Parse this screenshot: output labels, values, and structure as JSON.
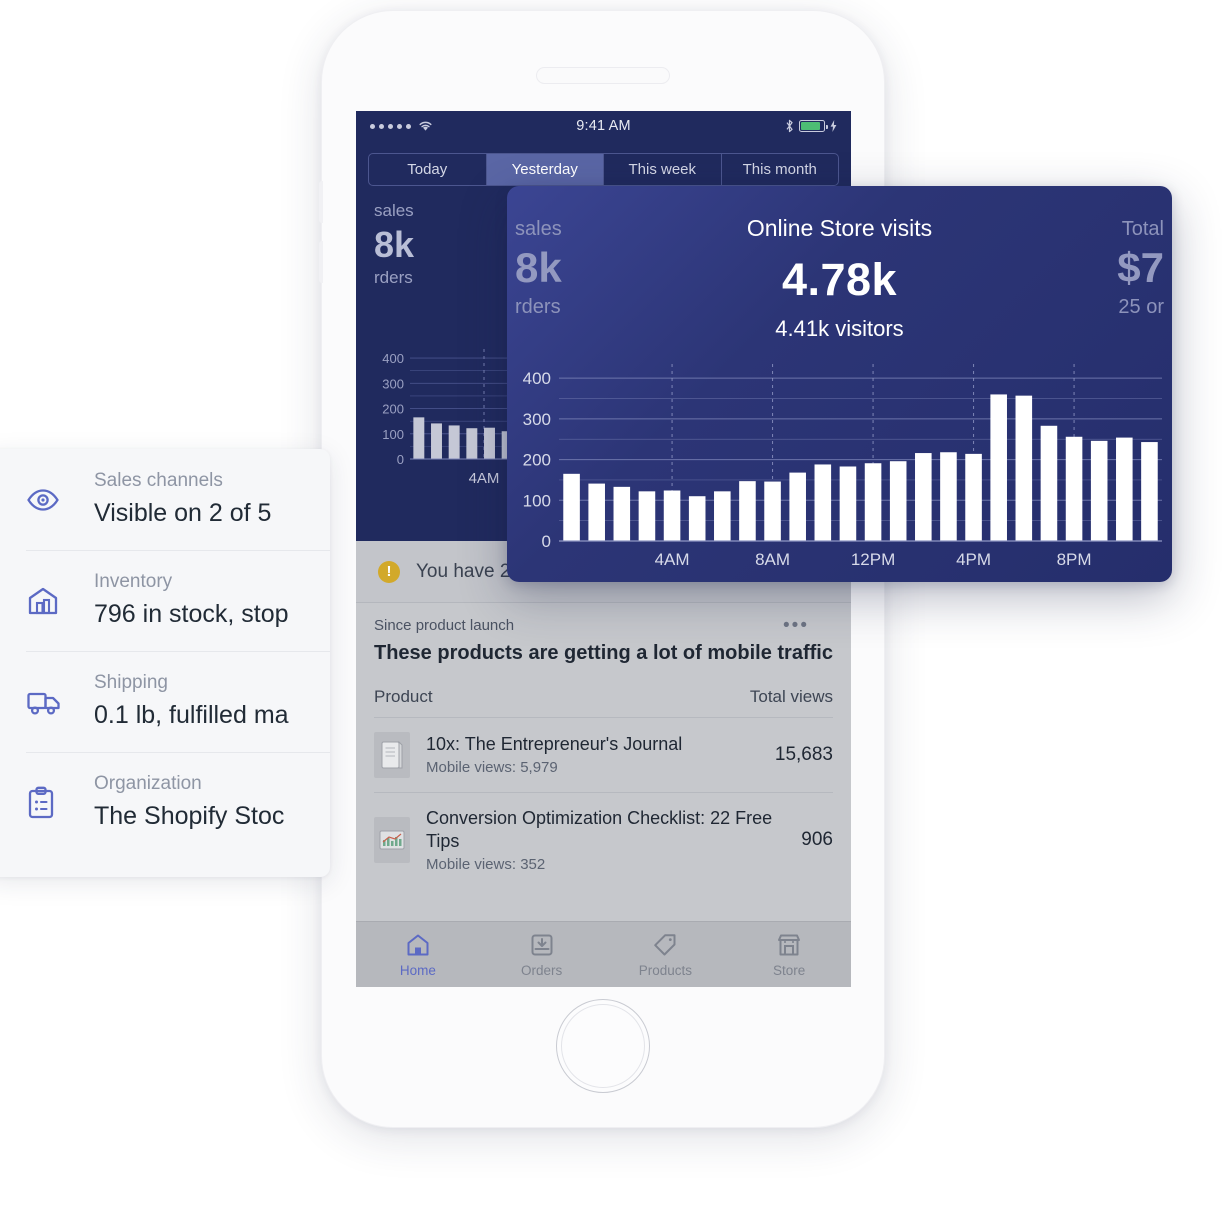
{
  "detail_panel": {
    "rows": [
      {
        "icon": "eye-icon",
        "label": "Sales channels",
        "value": "Visible on 2 of 5"
      },
      {
        "icon": "warehouse-icon",
        "label": "Inventory",
        "value": "796 in stock, stop"
      },
      {
        "icon": "truck-icon",
        "label": "Shipping",
        "value": "0.1 lb, fulfilled ma"
      },
      {
        "icon": "clipboard-icon",
        "label": "Organization",
        "value": "The Shopify Stoc"
      }
    ]
  },
  "phone": {
    "status_bar": {
      "time": "9:41 AM",
      "signal_dots": 5,
      "wifi": "wifi-icon",
      "bluetooth": "bluetooth-icon",
      "battery": "battery-icon",
      "charging": "bolt-icon"
    },
    "segmented": {
      "options": [
        "Today",
        "Yesterday",
        "This week",
        "This month"
      ],
      "selected": "Yesterday"
    },
    "dashboard": {
      "stat_label_1": "sales",
      "stat_value_1": "8k",
      "stat_label_2": "rders"
    },
    "notice": {
      "icon": "alert-icon",
      "text": "You have 2"
    },
    "insight": {
      "kicker": "Since product launch",
      "menu": "•••",
      "title": "These products are getting a lot of mobile traffic",
      "col_product": "Product",
      "col_views": "Total views",
      "rows": [
        {
          "thumb": "journal-thumb",
          "title": "10x: The Entrepreneur's Journal",
          "sub": "Mobile views: 5,979",
          "value": "15,683"
        },
        {
          "thumb": "chart-thumb",
          "title": "Conversion Optimization Checklist: 22 Free Tips",
          "sub": "Mobile views: 352",
          "value": "906"
        }
      ]
    },
    "tabbar": {
      "tabs": [
        {
          "icon": "home-icon",
          "label": "Home",
          "active": true
        },
        {
          "icon": "orders-icon",
          "label": "Orders",
          "active": false
        },
        {
          "icon": "tag-icon",
          "label": "Products",
          "active": false
        },
        {
          "icon": "store-icon",
          "label": "Store",
          "active": false
        }
      ]
    }
  },
  "overlay": {
    "title": "Online Store visits",
    "big_value": "4.78k",
    "subtitle": "4.41k visitors",
    "ghost_left": {
      "label": "sales",
      "big": "8k",
      "label2": "rders"
    },
    "ghost_right": {
      "label": "Total",
      "big": "$7",
      "label2": "25 or"
    }
  },
  "colors": {
    "brand_indigo": "#5c6ac4",
    "dark_navy": "#202a5e",
    "card_navy": "#2c3576",
    "bar_white": "#ffffff",
    "accent_yellow": "#d2a92a",
    "battery_green": "#4dbd74"
  },
  "chart_data": {
    "type": "bar",
    "title": "Online Store visits",
    "xlabel": "",
    "ylabel": "",
    "ylim": [
      0,
      420
    ],
    "grid": true,
    "y_ticks": [
      0,
      100,
      200,
      300,
      400
    ],
    "y_gridlines": [
      0,
      50,
      100,
      150,
      200,
      250,
      300,
      350,
      400
    ],
    "legend": "none",
    "x_tick_labels": [
      "4AM",
      "8AM",
      "12PM",
      "4PM",
      "8PM"
    ],
    "x_tick_indices": [
      4,
      8,
      12,
      16,
      20
    ],
    "categories": [
      "12AM",
      "1AM",
      "2AM",
      "3AM",
      "4AM",
      "5AM",
      "6AM",
      "7AM",
      "8AM",
      "9AM",
      "10AM",
      "11AM",
      "12PM",
      "1PM",
      "2PM",
      "3PM",
      "4PM",
      "5PM",
      "6PM",
      "7PM",
      "8PM",
      "9PM",
      "10PM",
      "11PM"
    ],
    "values": [
      165,
      141,
      133,
      122,
      124,
      110,
      122,
      147,
      146,
      168,
      188,
      183,
      191,
      196,
      216,
      218,
      214,
      360,
      357,
      283,
      256,
      246,
      254,
      243
    ],
    "mini_chart": {
      "type": "bar",
      "y_ticks": [
        0,
        100,
        200,
        300,
        400
      ],
      "x_tick_labels": [
        "4AM"
      ],
      "values": [
        165,
        141,
        133,
        122,
        124,
        110,
        122
      ]
    }
  }
}
